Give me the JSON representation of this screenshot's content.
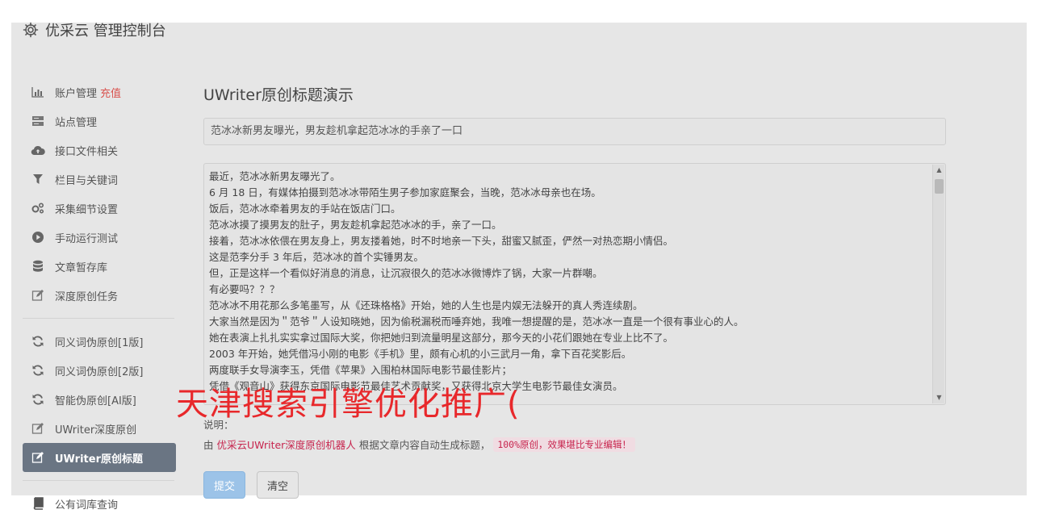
{
  "header": {
    "title": "优采云 管理控制台"
  },
  "sidebar": {
    "items": [
      {
        "label": "账户管理",
        "extra": "充值",
        "icon": "bar-chart-icon"
      },
      {
        "label": "站点管理",
        "icon": "server-icon"
      },
      {
        "label": "接口文件相关",
        "icon": "cloud-upload-icon"
      },
      {
        "label": "栏目与关键词",
        "icon": "filter-icon"
      },
      {
        "label": "采集细节设置",
        "icon": "gears-icon"
      },
      {
        "label": "手动运行测试",
        "icon": "play-circle-icon"
      },
      {
        "label": "文章暂存库",
        "icon": "database-icon"
      },
      {
        "label": "深度原创任务",
        "icon": "edit-icon"
      }
    ],
    "items2": [
      {
        "label": "同义词伪原创[1版]",
        "icon": "refresh-icon"
      },
      {
        "label": "同义词伪原创[2版]",
        "icon": "refresh-icon"
      },
      {
        "label": "智能伪原创[AI版]",
        "icon": "refresh-icon"
      },
      {
        "label": "UWriter深度原创",
        "icon": "edit-icon"
      },
      {
        "label": "UWriter原创标题",
        "icon": "edit-icon",
        "active": true
      }
    ],
    "bottom": {
      "label": "公有词库查询",
      "icon": "book-icon"
    }
  },
  "main": {
    "heading": "UWriter原创标题演示",
    "title_value": "范冰冰新男友曝光，男友趁机拿起范冰冰的手亲了一口",
    "content_lines": [
      "最近，范冰冰新男友曝光了。",
      "6 月 18 日，有媒体拍摄到范冰冰带陌生男子参加家庭聚会，当晚，范冰冰母亲也在场。",
      "饭后，范冰冰牵着男友的手站在饭店门口。",
      "范冰冰摸了摸男友的肚子，男友趁机拿起范冰冰的手，亲了一口。",
      "接着，范冰冰依偎在男友身上，男友搂着她，时不时地亲一下头，甜蜜又腻歪，俨然一对热恋期小情侣。",
      "这是范李分手 3 年后，范冰冰的首个实锤男友。",
      "但，正是这样一个看似好消息的消息，让沉寂很久的范冰冰微博炸了锅，大家一片群嘲。",
      "有必要吗？？？",
      "范冰冰不用花那么多笔墨写，从《还珠格格》开始，她的人生也是内娱无法躲开的真人秀连续剧。",
      "大家当然是因为＂范爷＂人设知晓她，因为偷税漏税而唾弃她，我唯一想提醒的是，范冰冰一直是一个很有事业心的人。",
      "她在表演上扎扎实实拿过国际大奖，你把她归到流量明星这部分，那今天的小花们跟她在专业上比不了。",
      "2003 年开始，她凭借冯小刚的电影《手机》里，颇有心机的小三武月一角，拿下百花奖影后。",
      "两度联手女导演李玉，凭借《苹果》入围柏林国际电影节最佳影片；",
      "凭借《观音山》获得东京国际电影节最佳艺术贡献奖，又获得北京大学生电影节最佳女演员。"
    ],
    "note_label": "说明：",
    "note_prefix": "由",
    "note_link": "优采云UWriter深度原创机器人",
    "note_middle": "根据文章内容自动生成标题，",
    "note_code": "100%原创，效果堪比专业编辑！",
    "submit_label": "提交",
    "clear_label": "清空"
  },
  "watermark": "天津搜索引擎优化推广(",
  "colors": {
    "active_bg": "#6a7583",
    "accent_red": "#d9534f",
    "primary_btn": "#9cc3e8",
    "watermark": "#e8282b"
  }
}
